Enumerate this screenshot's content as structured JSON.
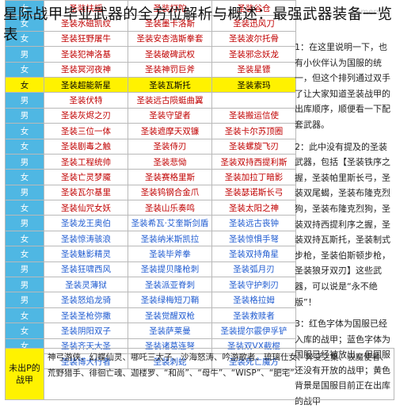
{
  "title": "星际战甲毕业武器的全方位解析与概述：最强武器装备一览表",
  "watermark": "gamersky",
  "rows": [
    {
      "sex": "女",
      "c1": "圣装扶摇",
      "c2": "圣装打陀",
      "c3": "圣装谷仓",
      "style": "red"
    },
    {
      "sex": "女",
      "c1": "圣装水磁凯纹",
      "c2": "圣装墨卡洛斯",
      "c3": "圣装迅风刀",
      "style": "red"
    },
    {
      "sex": "女",
      "c1": "圣装狂野屠牛",
      "c2": "圣装安杏浩斯拳套",
      "c3": "圣装波尔托骨",
      "style": "red"
    },
    {
      "sex": "男",
      "c1": "圣装犯神洛基",
      "c2": "圣装破碑武权",
      "c3": "圣装邪念妖龙",
      "style": "red"
    },
    {
      "sex": "女",
      "c1": "圣装冥河夜神",
      "c2": "圣装神罚巨斧",
      "c3": "圣装星镖",
      "style": "red"
    },
    {
      "sex": "女",
      "c1": "圣装超能新星",
      "c2": "圣装瓦斯托",
      "c3": "圣装索玛",
      "style": "yellow"
    },
    {
      "sex": "男",
      "c1": "圣装伏特",
      "c2": "圣装远古陨蜓曲翼",
      "c3": "",
      "style": "red"
    },
    {
      "sex": "男",
      "c1": "圣装灰烬之刃",
      "c2": "圣装守望者",
      "c3": "圣装搬运信使",
      "style": "red"
    },
    {
      "sex": "女",
      "c1": "圣装三位一体",
      "c2": "圣装遮摩天双镰",
      "c3": "圣装卡尔苏顶圈",
      "style": "red"
    },
    {
      "sex": "女",
      "c1": "圣装剧毒之触",
      "c2": "圣装侍刃",
      "c3": "圣装螺旋飞刃",
      "style": "red"
    },
    {
      "sex": "男",
      "c1": "圣装工程统帅",
      "c2": "圣装悲恸",
      "c3": "圣装双持西提利斯",
      "style": "red"
    },
    {
      "sex": "女",
      "c1": "圣装亡灵梦魇",
      "c2": "圣装赛格里斯",
      "c3": "圣装加拉丁暗影",
      "style": "red"
    },
    {
      "sex": "男",
      "c1": "圣装瓦尔基里",
      "c2": "圣装钨钢合金爪",
      "c3": "圣装瑟诺斯长弓",
      "style": "red"
    },
    {
      "sex": "女",
      "c1": "圣装仙咒女妖",
      "c2": "圣装山乐奏鸣",
      "c3": "圣装太阳之神",
      "style": "red"
    },
    {
      "sex": "男",
      "c1": "圣装龙王奥伯",
      "c2": "圣装希瓦·艾奎斯剑盾",
      "c3": "圣装远古丧钟",
      "style": "blue"
    },
    {
      "sex": "女",
      "c1": "圣装惊涛骇浪",
      "c2": "圣装纳米斯凯拉",
      "c3": "圣装惊惧手弩",
      "style": "blue"
    },
    {
      "sex": "女",
      "c1": "圣装魅影精灵",
      "c2": "圣装毕斧拳",
      "c3": "圣装双持角星",
      "style": "blue"
    },
    {
      "sex": "男",
      "c1": "圣装狂啸西风",
      "c2": "圣装提贝隆枪刺",
      "c3": "圣装弧月刃",
      "style": "blue"
    },
    {
      "sex": "男",
      "c1": "圣装灵薄狱",
      "c2": "圣装派亚脊刺",
      "c3": "圣装守护刺刃",
      "style": "blue"
    },
    {
      "sex": "男",
      "c1": "圣装怒焰龙骑",
      "c2": "圣装绿梅短刀鞘",
      "c3": "圣装格拉姆",
      "style": "blue"
    },
    {
      "sex": "女",
      "c1": "圣装圣枪弥撒",
      "c2": "圣装觉醒双枪",
      "c3": "圣装救赎者",
      "style": "blue"
    },
    {
      "sex": "女",
      "c1": "圣装阴阳双子",
      "c2": "圣装萨莱曼",
      "c3": "圣装提尔霰伊孚铲",
      "style": "blue"
    },
    {
      "sex": "女",
      "c1": "圣装齐天大圣",
      "c2": "圣装诸葛连弩",
      "c3": "圣装双VX截棍",
      "style": "blue"
    },
    {
      "sex": "男",
      "c1": "圣装博大行者",
      "c2": "圣装刺蛇",
      "c3": "圣装死亡魔方",
      "style": "blue"
    }
  ],
  "notes": [
    "1：在这里说明一下，也有小伙伴认为国服的统一，但这个排列通过双手了让大家知道圣装战甲的出库顺序，顺便看一下配套武器。",
    "2：此中没有提及的圣装武器，包括【圣装铁序之握，圣装帕里斯长弓，圣装双尾蝎，圣装布隆克烈狗，圣装布隆克烈狗，圣装双持西提利序之握，圣装双持瓦斯托，圣装制式步枪，圣装伯斯顿步枪，圣装狼牙双刃】这些武器，可以说是“永不绝版”！",
    "3：红色字体为国服已经入库的战甲；蓝色字体为国服已经被放出，但国服还没有开放的战甲；黄色背景是国服目前正在出库的战甲"
  ],
  "bottom": {
    "label": "未出P的战甲",
    "text": "神弓游侠、幻蝶仙灵、哪吒三太子、沙海怒涛、吟游歌者、琉璃仕女、异变之巢、驭魔使者、荒野猎手、徘徊亡魂、迦楼罗、“和尚”、“母牛”、“WISP”、“肥宅”"
  }
}
